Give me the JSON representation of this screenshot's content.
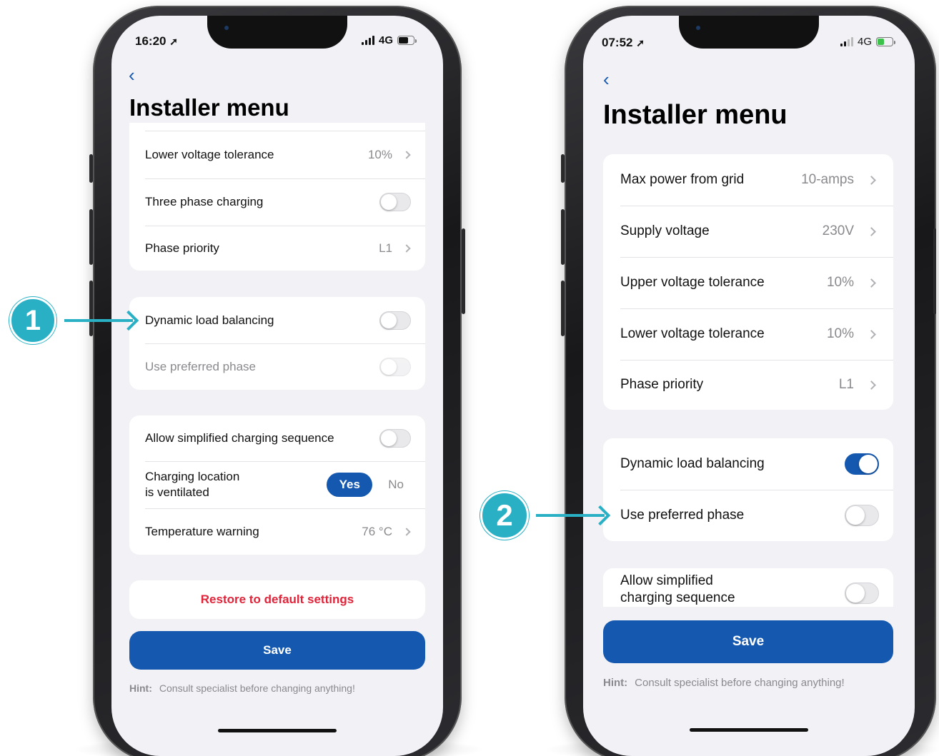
{
  "colors": {
    "accent": "#1458b0",
    "danger": "#e0243a",
    "callout": "#2ab0c5",
    "screen_bg": "#f2f2f6"
  },
  "phone1": {
    "status": {
      "time": "16:20",
      "location_icon": "location-arrow-icon",
      "network": "4G",
      "battery_level": 0.6
    },
    "back_icon": "chevron-left-icon",
    "title": "Installer menu",
    "group1": [
      {
        "label": "Lower voltage tolerance",
        "value": "10%",
        "type": "disclosure"
      },
      {
        "label": "Three phase charging",
        "type": "toggle",
        "on": false
      },
      {
        "label": "Phase priority",
        "value": "L1",
        "type": "disclosure"
      }
    ],
    "group2": [
      {
        "label": "Dynamic load balancing",
        "type": "toggle",
        "on": false
      },
      {
        "label": "Use preferred phase",
        "type": "toggle",
        "on": false,
        "disabled": true
      }
    ],
    "group3": {
      "simplified": {
        "label": "Allow simplified charging sequence",
        "on": false
      },
      "ventilated": {
        "label_line1": "Charging location",
        "label_line2": "is ventilated",
        "yes": "Yes",
        "no": "No",
        "selected": "Yes"
      },
      "temp": {
        "label": "Temperature warning",
        "value": "76 °C"
      }
    },
    "restore_label": "Restore to default settings",
    "save_label": "Save",
    "hint_label": "Hint:",
    "hint_text": "Consult specialist before changing anything!"
  },
  "phone2": {
    "status": {
      "time": "07:52",
      "location_icon": "location-arrow-icon",
      "network": "4G",
      "battery_level": 0.4,
      "charging": true
    },
    "back_icon": "chevron-left-icon",
    "title": "Installer menu",
    "group1": [
      {
        "label": "Max power from grid",
        "value": "10-amps"
      },
      {
        "label": "Supply voltage",
        "value": "230V"
      },
      {
        "label": "Upper voltage tolerance",
        "value": "10%"
      },
      {
        "label": "Lower voltage tolerance",
        "value": "10%"
      },
      {
        "label": "Phase priority",
        "value": "L1"
      }
    ],
    "group2": [
      {
        "label": "Dynamic load balancing",
        "type": "toggle",
        "on": true
      },
      {
        "label": "Use preferred phase",
        "type": "toggle",
        "on": false
      }
    ],
    "group3": {
      "label_line1": "Allow simplified",
      "label_line2": "charging sequence",
      "on": false
    },
    "save_label": "Save",
    "hint_label": "Hint:",
    "hint_text": "Consult specialist before changing anything!"
  },
  "callouts": {
    "one": "1",
    "two": "2"
  }
}
